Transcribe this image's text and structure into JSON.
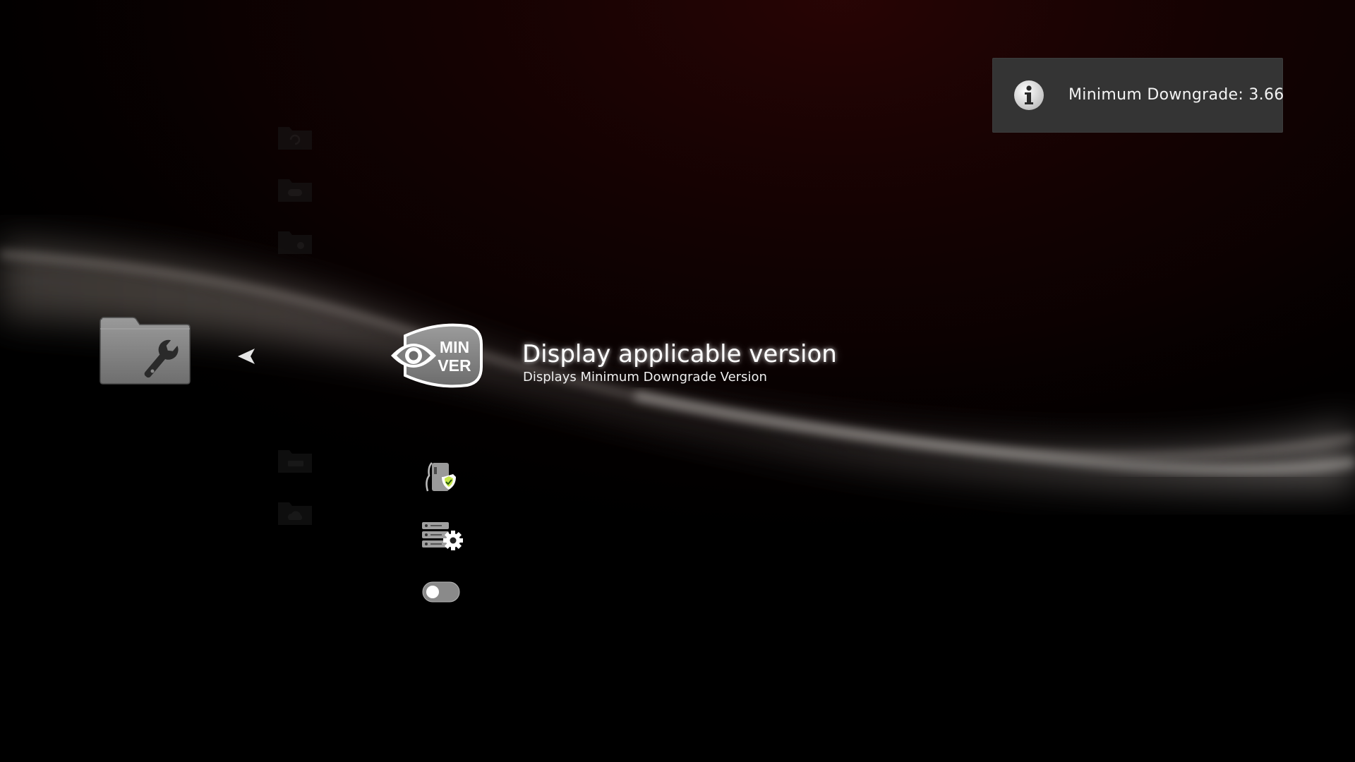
{
  "notification": {
    "icon": "info-icon",
    "text": "Minimum Downgrade: 3.66"
  },
  "category": {
    "icon": "folder-wrench-icon",
    "arrow_icon": "left-arrow-icon"
  },
  "faded_categories": [
    {
      "icon": "folder-refresh-icon"
    },
    {
      "icon": "folder-gamepad-icon"
    },
    {
      "icon": "folder-gear-icon"
    },
    {
      "icon": "folder-card-icon"
    },
    {
      "icon": "folder-cloud-icon"
    }
  ],
  "selected_item": {
    "icon": "min-ver-eye-icon",
    "icon_text_line1": "MIN",
    "icon_text_line2": "VER",
    "title": "Display applicable version",
    "description": "Displays Minimum Downgrade Version"
  },
  "items": [
    {
      "icon": "phone-shield-icon"
    },
    {
      "icon": "server-settings-icon"
    },
    {
      "icon": "toggle-icon",
      "state": "off"
    }
  ],
  "colors": {
    "background": "#000000",
    "toast_bg": "#343434",
    "icon_gray": "#8a8a8a",
    "accent_red": "#3a0808"
  }
}
